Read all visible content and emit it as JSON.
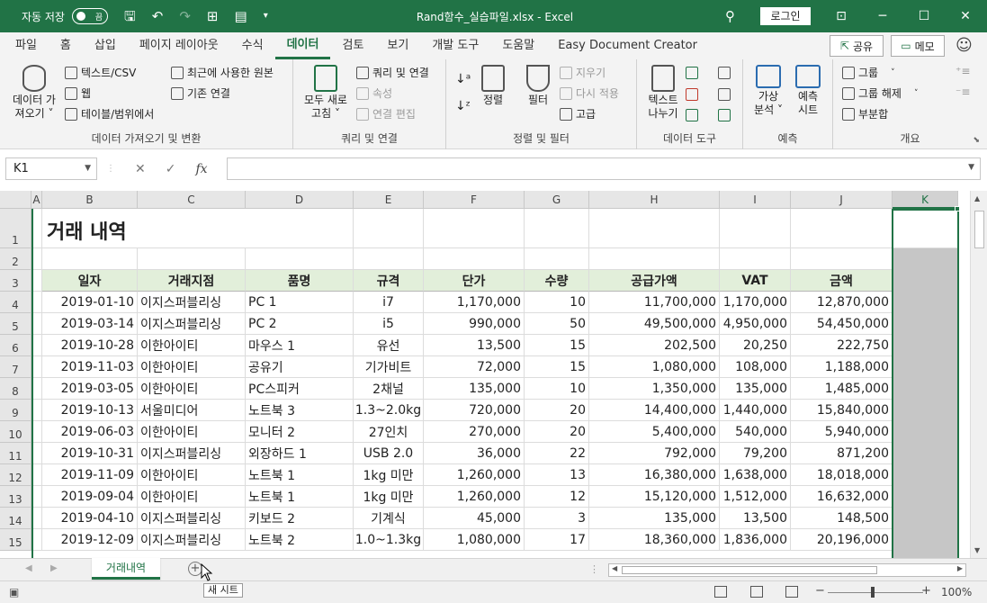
{
  "titlebar": {
    "autosave_label": "자동 저장",
    "autosave_state": "끔",
    "filename": "Rand함수_실습파일.xlsx  -  Excel",
    "login": "로그인",
    "minimize": "─",
    "restore": "☐",
    "close": "✕"
  },
  "tabs": [
    "파일",
    "홈",
    "삽입",
    "페이지 레이아웃",
    "수식",
    "데이터",
    "검토",
    "보기",
    "개발 도구",
    "도움말",
    "Easy Document Creator"
  ],
  "active_tab": "데이터",
  "share_label": "공유",
  "memo_label": "메모",
  "ribbon": {
    "get_data": {
      "big_label_1": "데이터 가",
      "big_label_2": "져오기 ˅",
      "text_csv": "텍스트/CSV",
      "web": "웹",
      "table_range": "테이블/범위에서",
      "recent_sources": "최근에 사용한 원본",
      "existing_conn": "기존 연결",
      "group_label": "데이터 가져오기 및 변환"
    },
    "queries": {
      "refresh_1": "모두 새로",
      "refresh_2": "고침 ˅",
      "queries_conn": "쿼리 및 연결",
      "properties": "속성",
      "edit_links": "연결 편집",
      "group_label": "쿼리 및 연결"
    },
    "sort_filter": {
      "sort": "정렬",
      "filter": "필터",
      "clear": "지우기",
      "reapply": "다시 적용",
      "advanced": "고급",
      "group_label": "정렬 및 필터"
    },
    "data_tools": {
      "text_to_col_1": "텍스트",
      "text_to_col_2": "나누기",
      "group_label": "데이터 도구"
    },
    "forecast": {
      "whatif_1": "가상",
      "whatif_2": "분석 ˅",
      "sheet_1": "예측",
      "sheet_2": "시트",
      "group_label": "예측"
    },
    "outline": {
      "group": "그룹",
      "ungroup": "그룹 해제",
      "subtotal": "부분합",
      "group_label": "개요"
    }
  },
  "formula_bar": {
    "name_box": "K1",
    "formula": ""
  },
  "columns": [
    "A",
    "B",
    "C",
    "D",
    "E",
    "F",
    "G",
    "H",
    "I",
    "J",
    "K"
  ],
  "selected_column": "K",
  "rows": [
    "1",
    "2",
    "3",
    "4",
    "5",
    "6",
    "7",
    "8",
    "9",
    "10",
    "11",
    "12",
    "13",
    "14",
    "15"
  ],
  "sheet_title": "거래 내역",
  "table": {
    "headers": [
      "일자",
      "거래지점",
      "품명",
      "규격",
      "단가",
      "수량",
      "공급가액",
      "VAT",
      "금액"
    ],
    "rows": [
      [
        "2019-01-10",
        "이지스퍼블리싱",
        "PC 1",
        "i7",
        "1,170,000",
        "10",
        "11,700,000",
        "1,170,000",
        "12,870,000"
      ],
      [
        "2019-03-14",
        "이지스퍼블리싱",
        "PC 2",
        "i5",
        "990,000",
        "50",
        "49,500,000",
        "4,950,000",
        "54,450,000"
      ],
      [
        "2019-10-28",
        "이한아이티",
        "마우스 1",
        "유선",
        "13,500",
        "15",
        "202,500",
        "20,250",
        "222,750"
      ],
      [
        "2019-11-03",
        "이한아이티",
        "공유기",
        "기가비트",
        "72,000",
        "15",
        "1,080,000",
        "108,000",
        "1,188,000"
      ],
      [
        "2019-03-05",
        "이한아이티",
        "PC스피커",
        "2채널",
        "135,000",
        "10",
        "1,350,000",
        "135,000",
        "1,485,000"
      ],
      [
        "2019-10-13",
        "서울미디어",
        "노트북 3",
        "1.3~2.0kg",
        "720,000",
        "20",
        "14,400,000",
        "1,440,000",
        "15,840,000"
      ],
      [
        "2019-06-03",
        "이한아이티",
        "모니터 2",
        "27인치",
        "270,000",
        "20",
        "5,400,000",
        "540,000",
        "5,940,000"
      ],
      [
        "2019-10-31",
        "이지스퍼블리싱",
        "외장하드 1",
        "USB 2.0",
        "36,000",
        "22",
        "792,000",
        "79,200",
        "871,200"
      ],
      [
        "2019-11-09",
        "이한아이티",
        "노트북 1",
        "1kg 미만",
        "1,260,000",
        "13",
        "16,380,000",
        "1,638,000",
        "18,018,000"
      ],
      [
        "2019-09-04",
        "이한아이티",
        "노트북 1",
        "1kg 미만",
        "1,260,000",
        "12",
        "15,120,000",
        "1,512,000",
        "16,632,000"
      ],
      [
        "2019-04-10",
        "이지스퍼블리싱",
        "키보드 2",
        "기계식",
        "45,000",
        "3",
        "135,000",
        "13,500",
        "148,500"
      ],
      [
        "2019-12-09",
        "이지스퍼블리싱",
        "노트북 2",
        "1.0~1.3kg",
        "1,080,000",
        "17",
        "18,360,000",
        "1,836,000",
        "20,196,000"
      ]
    ]
  },
  "sheet_tab": "거래내역",
  "add_sheet_tooltip": "새 시트",
  "status": {
    "zoom": "100%",
    "zoom_minus": "−",
    "zoom_plus": "+"
  },
  "colors": {
    "accent": "#217346",
    "header_fill": "#e2efda",
    "selection_fill": "#c6c6c6"
  }
}
